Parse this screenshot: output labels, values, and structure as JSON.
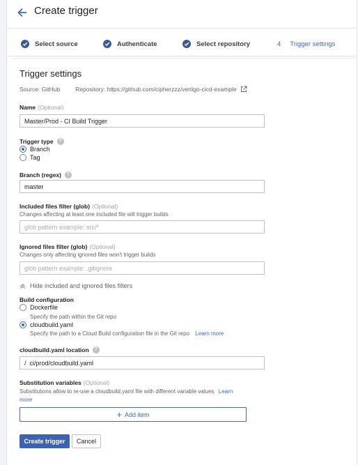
{
  "header": {
    "title": "Create trigger"
  },
  "stepper": {
    "steps": [
      {
        "label": "Select source",
        "done": true
      },
      {
        "label": "Authenticate",
        "done": true
      },
      {
        "label": "Select repository",
        "done": true
      },
      {
        "number": "4",
        "label": "Trigger settings",
        "done": false
      }
    ]
  },
  "form": {
    "section_title": "Trigger settings",
    "source_text": "Source: GitHub",
    "repository_text": "Repository: https://github.com/cipherzzz/vertigo-cicd-example",
    "name": {
      "label": "Name",
      "optional": "(Optional)",
      "value": "Master/Prod - CI Build Trigger"
    },
    "trigger_type": {
      "label": "Trigger type",
      "options": [
        "Branch",
        "Tag"
      ],
      "selected": "Branch"
    },
    "branch": {
      "label": "Branch (regex)",
      "value": "master"
    },
    "included": {
      "label": "Included files filter (glob)",
      "optional": "(Optional)",
      "hint": "Changes affecting at least one included file will trigger builds",
      "placeholder": "glob pattern example: src/*"
    },
    "ignored": {
      "label": "Ignored files filter (glob)",
      "optional": "(Optional)",
      "hint": "Changes only affecting ignored files won't trigger builds",
      "placeholder": "glob pattern example: .gitignore"
    },
    "hide_filters_link": "Hide included and ignored files filters",
    "build_config": {
      "label": "Build configuration",
      "dockerfile": {
        "label": "Dockerfile",
        "hint": "Specify the path within the Git repo"
      },
      "cloudbuild": {
        "label": "cloudbuild.yaml",
        "hint": "Specify the path to a Cloud Build configuration file in the Git repo",
        "learn_more": "Learn more"
      },
      "selected": "cloudbuild.yaml"
    },
    "cloudbuild_location": {
      "label": "cloudbuild.yaml location",
      "value": "/  ci/prod/cloudbuild.yaml"
    },
    "substitution": {
      "label": "Substitution variables",
      "optional": "(Optional)",
      "hint": "Substitutions allow to re-use a cloudbuild.yaml file with different variable values",
      "learn_more_1": "Learn",
      "learn_more_2": "more",
      "add_item": "Add item"
    },
    "create_button": "Create trigger",
    "cancel_button": "Cancel"
  },
  "colors": {
    "accent": "#3f6ab5",
    "primary_button": "#3d63b0",
    "step_check": "#3d5a98"
  },
  "icons": [
    "arrow-back-icon",
    "check-circle-icon",
    "open-in-new-icon",
    "help-icon",
    "chevron-up-icon",
    "plus-icon"
  ]
}
